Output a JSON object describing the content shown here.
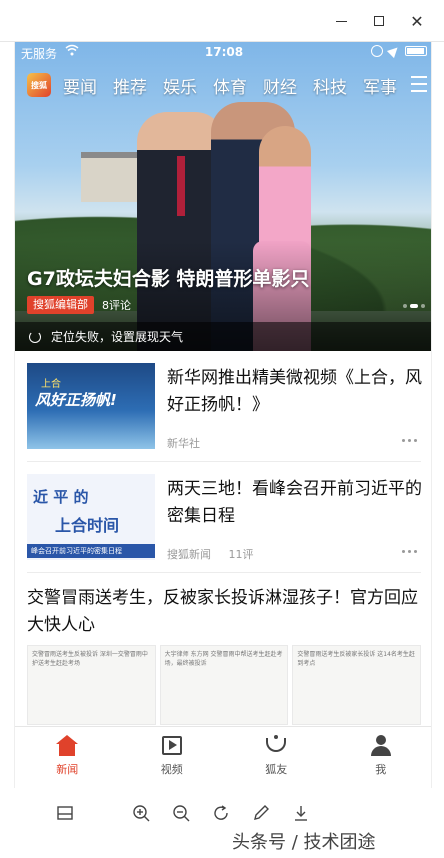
{
  "status_bar": {
    "carrier": "无服务",
    "time": "17:08"
  },
  "app": {
    "logo_text": "搜狐"
  },
  "channels": [
    "要闻",
    "推荐",
    "娱乐",
    "体育",
    "财经",
    "科技",
    "军事"
  ],
  "hero": {
    "title": "G7政坛夫妇合影 特朗普形单影只",
    "source": "搜狐编辑部",
    "comments": "8评论"
  },
  "weather": {
    "text": "定位失败，设置展现天气"
  },
  "feed": [
    {
      "title": "新华网推出精美微视频《上合，风好正扬帆！》",
      "source": "新华社",
      "comments": "",
      "thumb_caption_top": "上合",
      "thumb_caption": "风好正扬帆!"
    },
    {
      "title": "两天三地！看峰会召开前习近平的密集日程",
      "source": "搜狐新闻",
      "comments": "11评",
      "thumb_line1": "近 平 的",
      "thumb_line2": "上合时间",
      "thumb_banner": "峰会召开前习近平的密集日程"
    }
  ],
  "big_item": {
    "title": "交警冒雨送考生，反被家长投诉淋湿孩子！官方回应大快人心",
    "thumbs": [
      "交警冒雨送考生反被投诉 深圳一交警冒雨中护送考生赶赴考场",
      "大宇律师 东方网 交警冒雨中帮送考生赶赴考场，最终被投诉",
      "交警冒雨送考生反被家长投诉 这14名考生赶到考点"
    ]
  },
  "tabs": [
    {
      "label": "新闻",
      "icon": "home-icon",
      "active": true
    },
    {
      "label": "视频",
      "icon": "video-icon",
      "active": false
    },
    {
      "label": "狐友",
      "icon": "fox-friend-icon",
      "active": false
    },
    {
      "label": "我",
      "icon": "profile-icon",
      "active": false
    }
  ],
  "watermark": "头条号 / 技术团途",
  "colors": {
    "accent": "#e0422b",
    "nav_text": "#ffffff"
  }
}
